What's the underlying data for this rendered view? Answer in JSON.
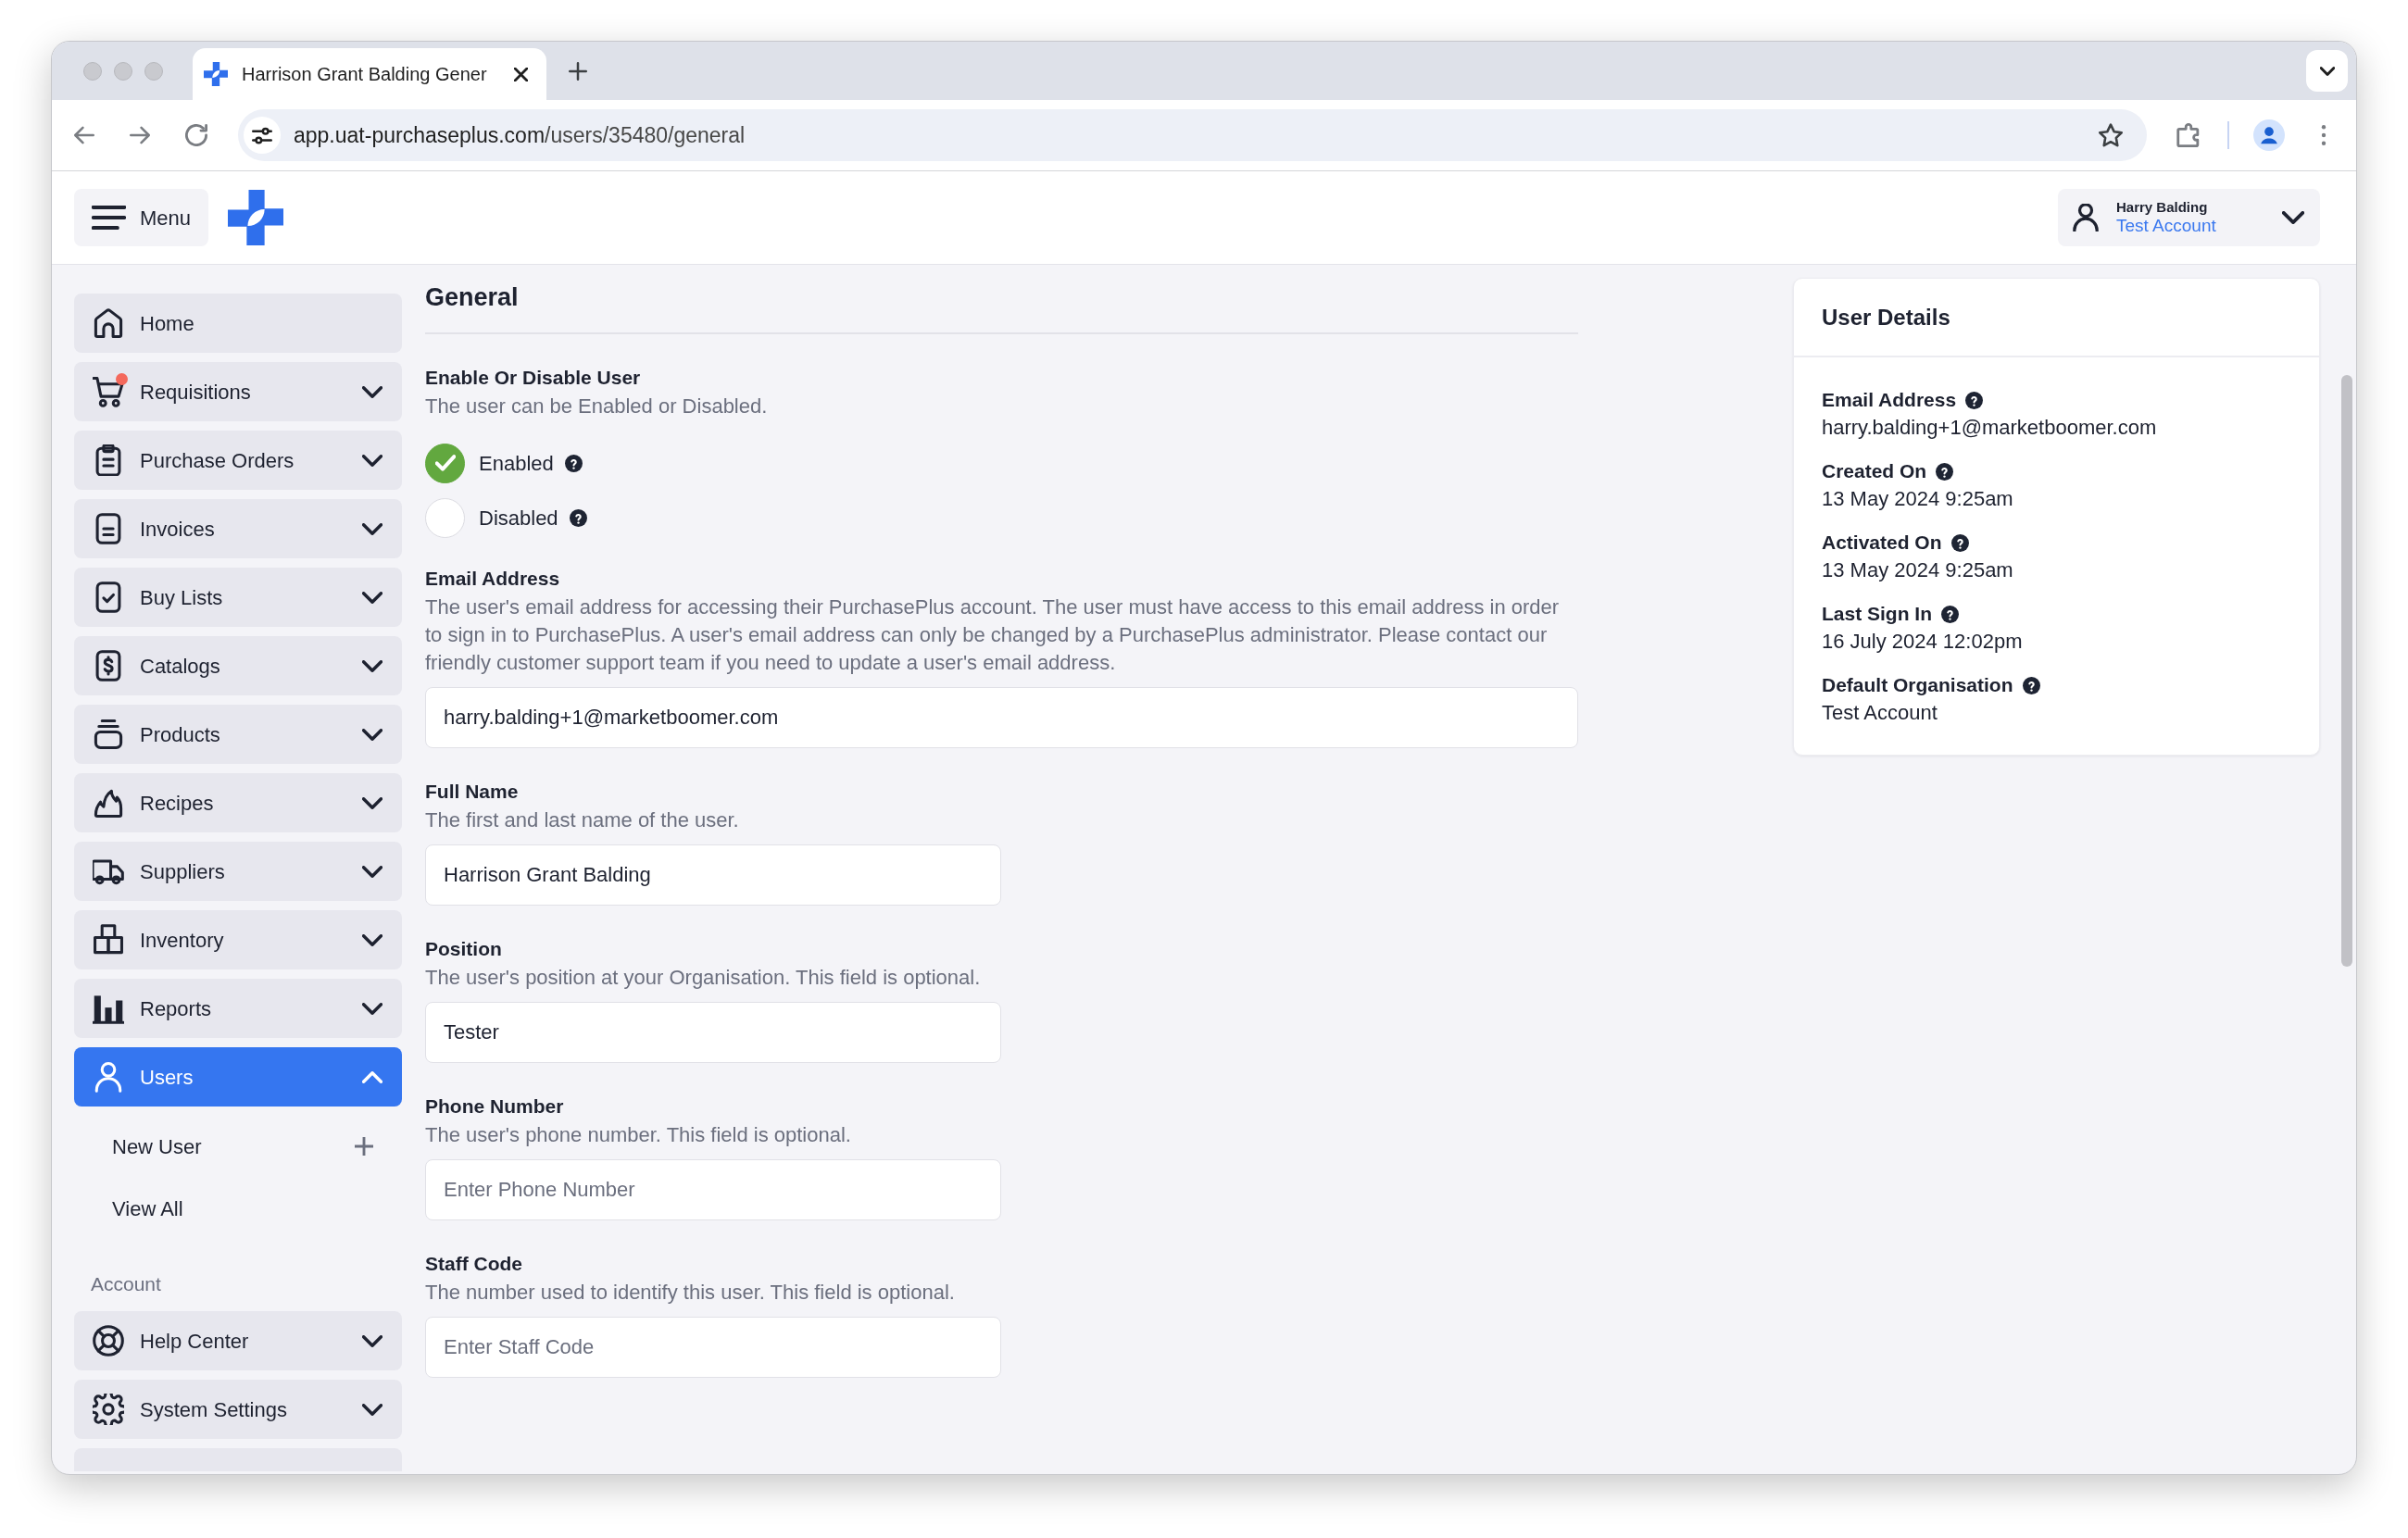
{
  "browser": {
    "tabs": [
      {
        "title": "Harrison Grant Balding Gener",
        "selected": true
      }
    ],
    "url_host": "app.uat-purchaseplus.com",
    "url_path": "/users/35480/general"
  },
  "header": {
    "menu_label": "Menu",
    "user": {
      "name": "Harry Balding",
      "account": "Test Account"
    }
  },
  "sidebar": {
    "sections": [
      {
        "items": [
          {
            "label": "Home",
            "kind": "link",
            "selected": false,
            "notification": false
          },
          {
            "label": "Requisitions",
            "kind": "menu",
            "expanded": false,
            "selected": false,
            "notification": true
          },
          {
            "label": "Purchase Orders",
            "kind": "menu",
            "expanded": false,
            "selected": false,
            "notification": false
          },
          {
            "label": "Invoices",
            "kind": "menu",
            "expanded": false,
            "selected": false,
            "notification": false
          },
          {
            "label": "Buy Lists",
            "kind": "menu",
            "expanded": false,
            "selected": false,
            "notification": false
          },
          {
            "label": "Catalogs",
            "kind": "menu",
            "expanded": false,
            "selected": false,
            "notification": false
          },
          {
            "label": "Products",
            "kind": "menu",
            "expanded": false,
            "selected": false,
            "notification": false
          },
          {
            "label": "Recipes",
            "kind": "menu",
            "expanded": false,
            "selected": false,
            "notification": false
          },
          {
            "label": "Suppliers",
            "kind": "menu",
            "expanded": false,
            "selected": false,
            "notification": false
          },
          {
            "label": "Inventory",
            "kind": "menu",
            "expanded": false,
            "selected": false,
            "notification": false
          },
          {
            "label": "Reports",
            "kind": "menu",
            "expanded": false,
            "selected": false,
            "notification": false
          },
          {
            "label": "Users",
            "kind": "menu",
            "expanded": true,
            "selected": true,
            "notification": false,
            "children": [
              {
                "label": "New User",
                "kind": "add",
                "selected": false
              },
              {
                "label": "View All",
                "kind": "link",
                "selected": false
              }
            ]
          }
        ]
      },
      {
        "title": "Account",
        "items": [
          {
            "label": "Help Center",
            "kind": "menu",
            "expanded": false,
            "selected": false,
            "notification": false
          },
          {
            "label": "System Settings",
            "kind": "menu",
            "expanded": false,
            "selected": false,
            "notification": false
          }
        ]
      }
    ]
  },
  "form": {
    "title": "General",
    "groups": [
      {
        "kind": "radio",
        "label": "Enable Or Disable User",
        "description": "The user can be Enabled or Disabled.",
        "options": [
          {
            "label": "Enabled",
            "selected": true
          },
          {
            "label": "Disabled",
            "selected": false
          }
        ]
      },
      {
        "kind": "email",
        "label": "Email Address",
        "description": "The user's email address for accessing their PurchasePlus account. The user must have access to this email address in order to sign in to PurchasePlus. A user's email address can only be changed by a PurchasePlus administrator. Please contact our friendly customer support team if you need to update a user's email address.",
        "value": "harry.balding+1@marketboomer.com"
      },
      {
        "kind": "text",
        "label": "Full Name",
        "description": "The first and last name of the user.",
        "value": "Harrison Grant Balding"
      },
      {
        "kind": "text",
        "label": "Position",
        "description": "The user's position at your Organisation. This field is optional.",
        "value": "Tester"
      },
      {
        "kind": "text",
        "label": "Phone Number",
        "description": "The user's phone number. This field is optional.",
        "placeholder": "Enter Phone Number"
      },
      {
        "kind": "text",
        "label": "Staff Code",
        "description": "The number used to identify this user. This field is optional.",
        "placeholder": "Enter Staff Code"
      }
    ]
  },
  "details": {
    "title": "User Details",
    "fields": [
      {
        "label": "Email Address",
        "value": "harry.balding+1@marketboomer.com"
      },
      {
        "label": "Created On",
        "value": "13 May 2024 9:25am"
      },
      {
        "label": "Activated On",
        "value": "13 May 2024 9:25am"
      },
      {
        "label": "Last Sign In",
        "value": "16 July 2024 12:02pm"
      },
      {
        "label": "Default Organisation",
        "value": "Test Account"
      }
    ]
  }
}
